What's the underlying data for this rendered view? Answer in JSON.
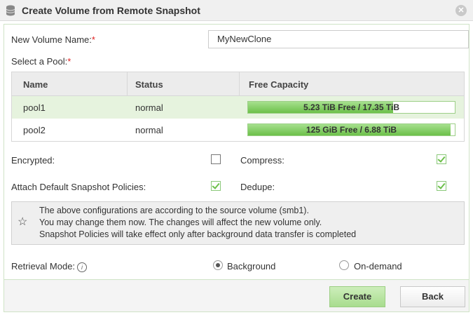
{
  "dialog": {
    "title": "Create Volume from Remote Snapshot",
    "title_icon": "database-icon",
    "close_icon": "close-icon"
  },
  "form": {
    "volume_name_label": "New Volume Name:",
    "volume_name_value": "MyNewClone",
    "required_mark": "*",
    "pool_label": "Select a Pool:"
  },
  "pool_table": {
    "columns": [
      "Name",
      "Status",
      "Free Capacity"
    ],
    "rows": [
      {
        "name": "pool1",
        "status": "normal",
        "capacity_text": "5.23 TiB Free / 17.35 TiB",
        "used_fraction": 0.7,
        "selected": true
      },
      {
        "name": "pool2",
        "status": "normal",
        "capacity_text": "125 GiB Free / 6.88 TiB",
        "used_fraction": 0.98,
        "selected": false
      }
    ]
  },
  "options": {
    "encrypted_label": "Encrypted:",
    "encrypted_checked": false,
    "compress_label": "Compress:",
    "compress_checked": true,
    "attach_policies_label": "Attach Default Snapshot Policies:",
    "attach_policies_checked": true,
    "dedupe_label": "Dedupe:",
    "dedupe_checked": true
  },
  "note": {
    "icon": "star-icon",
    "lines": [
      "The above configurations are according to the source volume (smb1).",
      "You may change them now. The changes will affect the new volume only.",
      "Snapshot Policies will take effect only after background data transfer is completed"
    ]
  },
  "retrieval": {
    "label": "Retrieval Mode:",
    "info_icon": "info-icon",
    "options": [
      "Background",
      "On-demand"
    ],
    "selected": "Background"
  },
  "buttons": {
    "create": "Create",
    "back": "Back"
  },
  "colors": {
    "accent_green": "#6cc04a",
    "selected_row": "#e6f3de",
    "required": "#e02020"
  }
}
